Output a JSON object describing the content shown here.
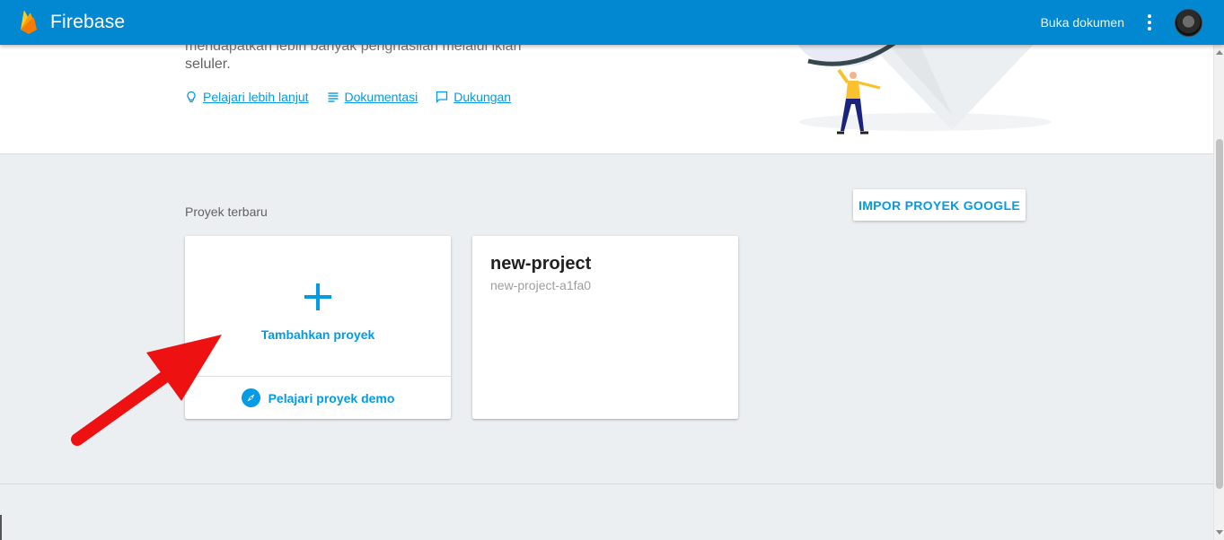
{
  "header": {
    "brand": "Firebase",
    "docs_link": "Buka dokumen",
    "more_icon": "more-vert-icon",
    "avatar": "user-avatar"
  },
  "hero": {
    "cut_text": "mendapatkan lebih banyak penghasilan melalui iklan",
    "line_text": "seluler.",
    "links": [
      {
        "label": "Pelajari lebih lanjut",
        "icon": "lightbulb-icon"
      },
      {
        "label": "Dokumentasi",
        "icon": "document-icon"
      },
      {
        "label": "Dukungan",
        "icon": "chat-icon"
      }
    ]
  },
  "main": {
    "section_label": "Proyek terbaru",
    "import_button": "IMPOR PROYEK GOOGLE",
    "add_card": {
      "icon": "plus-icon",
      "label": "Tambahkan proyek",
      "demo_icon": "compass-icon",
      "demo_label": "Pelajari proyek demo"
    },
    "projects": [
      {
        "name": "new-project",
        "id": "new-project-a1fa0"
      }
    ]
  },
  "colors": {
    "app_bar": "#0288d1",
    "accent": "#039be5",
    "background": "#eceff1",
    "annotation_arrow": "#ee1111"
  }
}
